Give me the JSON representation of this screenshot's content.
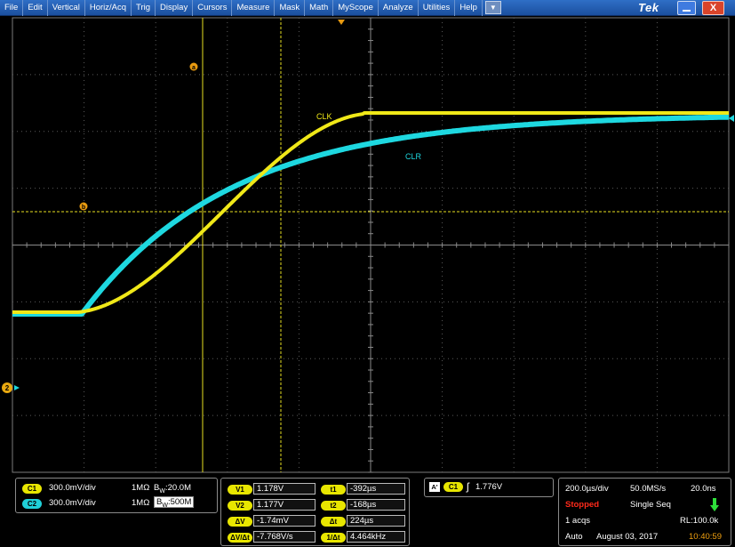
{
  "menu": {
    "items": [
      "File",
      "Edit",
      "Vertical",
      "Horiz/Acq",
      "Trig",
      "Display",
      "Cursors",
      "Measure",
      "Mask",
      "Math",
      "MyScope",
      "Analyze",
      "Utilities",
      "Help"
    ],
    "dropdown_glyph": "▼",
    "logo": "Tek",
    "close_glyph": "X"
  },
  "waveforms": {
    "ch1": {
      "label": "CLK",
      "color": "#f0e818"
    },
    "ch2": {
      "label": "CLR",
      "color": "#1ed8e0"
    }
  },
  "markers": {
    "cursor_a": "a",
    "cursor_b": "b",
    "ch2_ground": "2"
  },
  "channels": [
    {
      "pill": "C1",
      "scale": "300.0mV/div",
      "impedance": "1MΩ",
      "bw_prefix": "B",
      "bw_sub": "W",
      "bw": ":20.0M"
    },
    {
      "pill": "C2",
      "scale": "300.0mV/div",
      "impedance": "1MΩ",
      "bw_prefix": "B",
      "bw_sub": "W",
      "bw": ":500M"
    }
  ],
  "cursors": {
    "v1_label": "V1",
    "v1": "1.178V",
    "v2_label": "V2",
    "v2": "1.177V",
    "dv_label": "ΔV",
    "dv": "-1.74mV",
    "dvdt_label": "ΔV/Δt",
    "dvdt": "-7.768V/s",
    "t1_label": "t1",
    "t1": "-392µs",
    "t2_label": "t2",
    "t2": "-168µs",
    "dt_label": "Δt",
    "dt": "224µs",
    "inv_dt_label": "1/Δt",
    "inv_dt": "4.464kHz"
  },
  "trigger": {
    "mode_label": "A'",
    "source": "C1",
    "slope_glyph": "ʃ",
    "level": "1.776V"
  },
  "acquisition": {
    "timebase": "200.0µs/div",
    "sample_rate": "50.0MS/s",
    "resolution": "20.0ns",
    "state": "Stopped",
    "seq_mode": "Single Seq",
    "acqs": "1 acqs",
    "record_length": "RL:100.0k",
    "trigger_mode": "Auto",
    "date": "August 03, 2017",
    "time": "10:40:59"
  },
  "colors": {
    "menubar": "#2364c0",
    "ch1": "#f0e818",
    "ch2": "#1ed8e0",
    "cursor": "#f0e818",
    "marker": "#e89a10",
    "stopped": "#ff2a1a",
    "time": "#f0a010"
  }
}
